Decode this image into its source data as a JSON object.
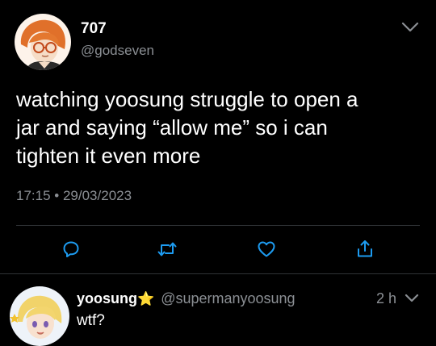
{
  "main_tweet": {
    "display_name": "707",
    "handle": "@godseven",
    "text_lines": [
      "watching yoosung struggle to open a",
      "jar and saying “allow me” so i can",
      "tighten it even more"
    ],
    "time": "17:15",
    "separator": "•",
    "date": "29/03/2023",
    "actions": [
      "reply-icon",
      "retweet-icon",
      "like-icon",
      "share-icon"
    ],
    "more_icon": "chevron-down-icon"
  },
  "reply": {
    "display_name": "yoosung",
    "badge": "⭐",
    "handle": "@supermanyoosung",
    "age": "2 h",
    "text": "wtf?"
  },
  "colors": {
    "background": "#000000",
    "text": "#ffffff",
    "muted": "#8b8f94",
    "divider": "#2f3336"
  }
}
